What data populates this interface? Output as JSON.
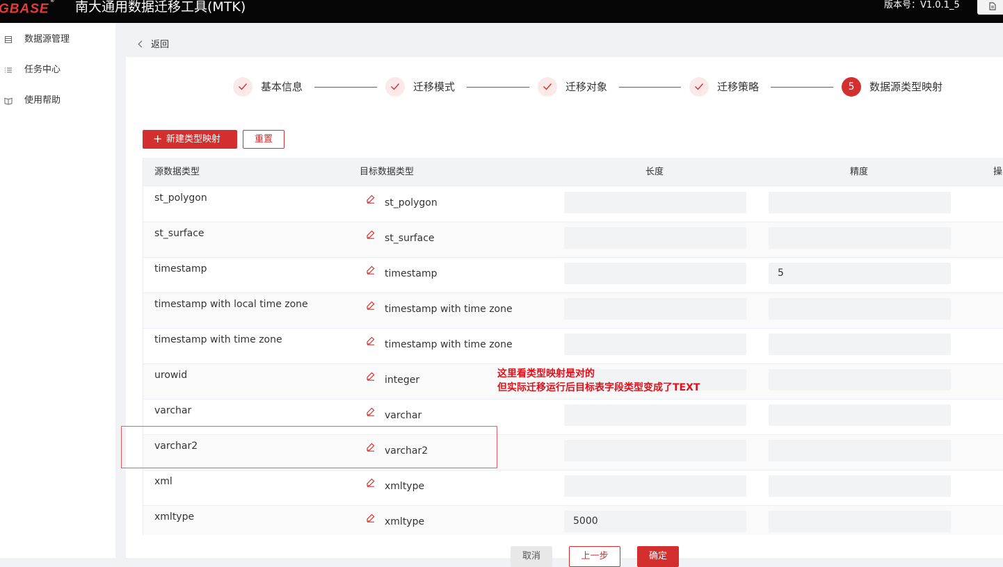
{
  "header": {
    "logo_text": "GBASE",
    "logo_mark": "®",
    "app_title": "南大通用数据迁移工具(MTK)",
    "version": "版本号：V1.0.1_5",
    "corner_icon": "document-icon"
  },
  "sidebar": {
    "items": [
      {
        "label": "数据源管理",
        "icon": "database-list-icon"
      },
      {
        "label": "任务中心",
        "icon": "list-icon"
      },
      {
        "label": "使用帮助",
        "icon": "book-icon"
      }
    ]
  },
  "nav": {
    "back_label": "返回"
  },
  "steps": [
    {
      "label": "基本信息",
      "status": "done"
    },
    {
      "label": "迁移模式",
      "status": "done"
    },
    {
      "label": "迁移对象",
      "status": "done"
    },
    {
      "label": "迁移策略",
      "status": "done"
    },
    {
      "label": "数据源类型映射",
      "status": "active",
      "number": "5"
    }
  ],
  "toolbar": {
    "new_label": "新建类型映射",
    "reset_label": "重置"
  },
  "table": {
    "columns": [
      "源数据类型",
      "目标数据类型",
      "长度",
      "精度",
      "操"
    ],
    "rows": [
      {
        "source": "st_polygon",
        "target": "st_polygon",
        "length": "",
        "precision": ""
      },
      {
        "source": "st_surface",
        "target": "st_surface",
        "length": "",
        "precision": ""
      },
      {
        "source": "timestamp",
        "target": "timestamp",
        "length": "",
        "precision": "5"
      },
      {
        "source": "timestamp with local time zone",
        "target": "timestamp with time zone",
        "length": "",
        "precision": ""
      },
      {
        "source": "timestamp with time zone",
        "target": "timestamp with time zone",
        "length": "",
        "precision": ""
      },
      {
        "source": "urowid",
        "target": "integer",
        "length": "",
        "precision": ""
      },
      {
        "source": "varchar",
        "target": "varchar",
        "length": "",
        "precision": ""
      },
      {
        "source": "varchar2",
        "target": "varchar2",
        "length": "",
        "precision": ""
      },
      {
        "source": "xml",
        "target": "xmltype",
        "length": "",
        "precision": ""
      },
      {
        "source": "xmltype",
        "target": "xmltype",
        "length": "5000",
        "precision": ""
      }
    ]
  },
  "annotation": {
    "line1": "这里看类型映射是对的",
    "line2": "但实际迁移运行后目标表字段类型变成了TEXT"
  },
  "footer": {
    "cancel_label": "取消",
    "prev_label": "上一步",
    "ok_label": "确定"
  },
  "colors": {
    "accent": "#d32f2f",
    "annotation": "#e0111a"
  }
}
